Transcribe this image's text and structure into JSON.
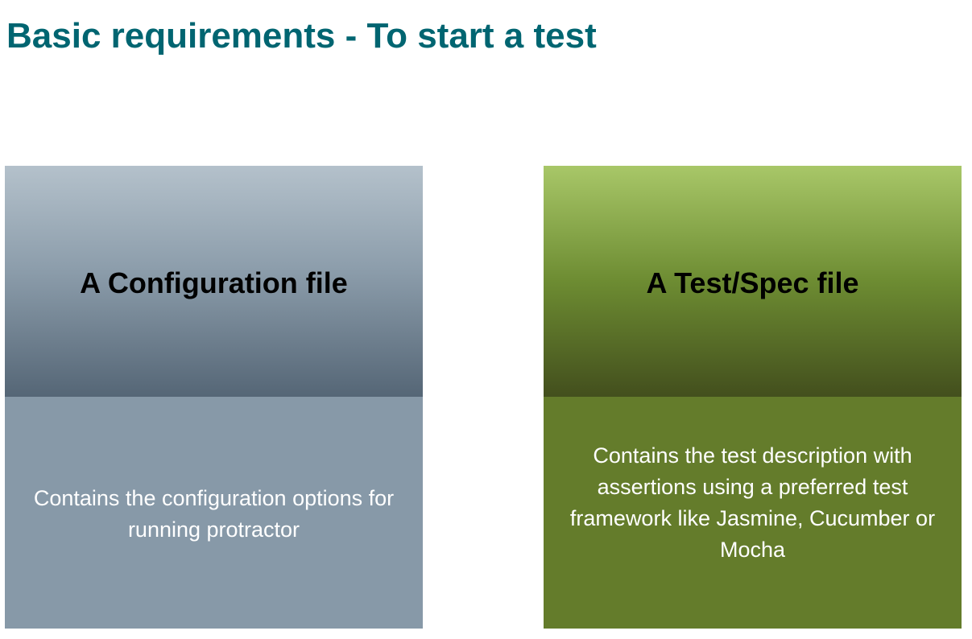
{
  "slide": {
    "title": "Basic requirements - To start a test",
    "title_color": "#006571"
  },
  "cards": [
    {
      "heading": "A Configuration file",
      "description": "Contains the configuration options for running protractor",
      "header_gradient": [
        "#b4c1cb",
        "#556676"
      ],
      "body_color": "#8799a8"
    },
    {
      "heading": "A Test/Spec file",
      "description": "Contains the test description with assertions using a preferred test framework like Jasmine, Cucumber or Mocha",
      "header_gradient": [
        "#a8c768",
        "#434f1d"
      ],
      "body_color": "#647c2b"
    }
  ]
}
